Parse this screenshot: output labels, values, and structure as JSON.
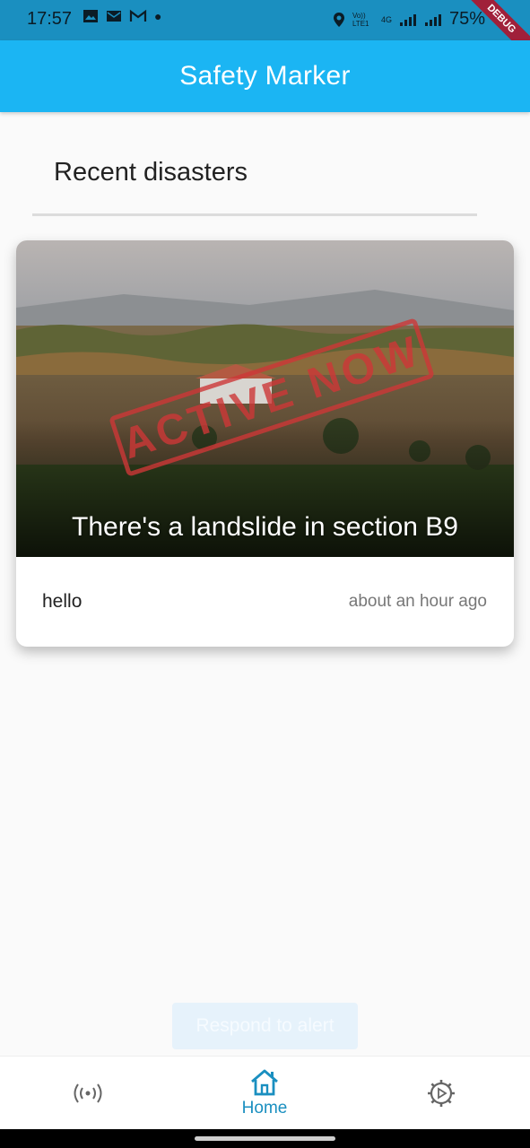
{
  "status_bar": {
    "time": "17:57",
    "network": "4G",
    "carrier_label": "Vo)) LTE1",
    "battery": "75%",
    "debug_banner": "DEBUG"
  },
  "app_bar": {
    "title": "Safety Marker"
  },
  "main": {
    "section_title": "Recent disasters",
    "cards": [
      {
        "stamp": "ACTIVE NOW",
        "headline": "There's a landslide in section B9",
        "description": "hello",
        "time_ago": "about an hour ago"
      }
    ],
    "respond_button": "Respond to alert"
  },
  "bottom_nav": {
    "items": [
      {
        "icon": "broadcast-icon",
        "label": ""
      },
      {
        "icon": "home-icon",
        "label": "Home"
      },
      {
        "icon": "settings-icon",
        "label": ""
      }
    ],
    "active_color": "#1a8fc0"
  },
  "colors": {
    "app_bar": "#1bb5f3",
    "status_bar": "#1a8fc0",
    "stamp": "#cd3737"
  }
}
